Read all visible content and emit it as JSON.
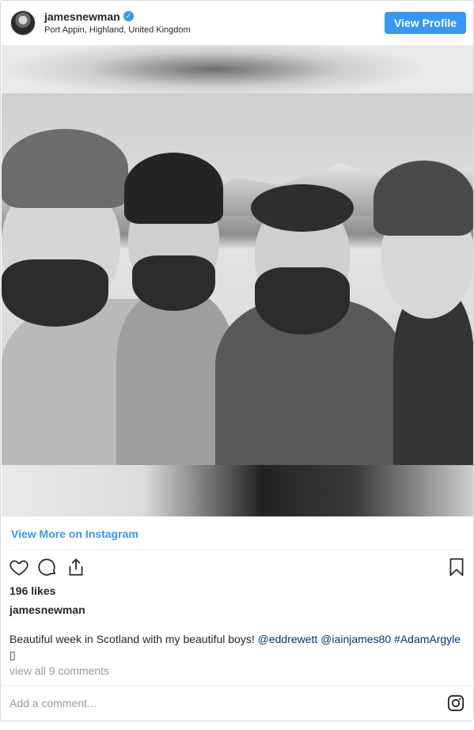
{
  "header": {
    "username": "jamesnewman",
    "verified_symbol": "✓",
    "location": "Port Appin, Highland, United Kingdom",
    "view_profile_label": "View Profile"
  },
  "embed": {
    "view_more_label": "View More on Instagram"
  },
  "post": {
    "likes": "196 likes",
    "caption_username": "jamesnewman",
    "caption_text": "Beautiful week in Scotland with my beautiful boys! ",
    "mentions": [
      "@eddrewett",
      "@iainjames80",
      "#AdamArgyle"
    ],
    "caption_end": "▯",
    "view_comments": "view all 9 comments",
    "add_comment_placeholder": "Add a comment..."
  },
  "colors": {
    "accent": "#3897f0",
    "tag": "#003569",
    "muted": "#999999",
    "text": "#262626"
  },
  "icons": [
    "avatar",
    "verified-badge-icon",
    "heart-icon",
    "comment-icon",
    "share-icon",
    "bookmark-icon",
    "instagram-logo-icon"
  ]
}
